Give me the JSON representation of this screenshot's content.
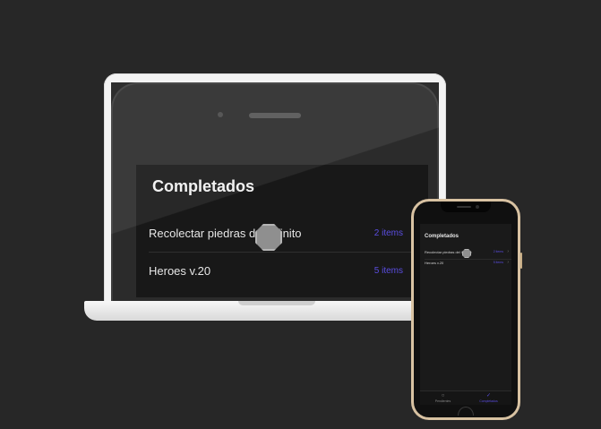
{
  "app": {
    "title": "Completados",
    "items": [
      {
        "label": "Recolectar piedras del infinito",
        "count": "2 items"
      },
      {
        "label": "Heroes v.20",
        "count": "5 items"
      }
    ]
  },
  "tabbar": {
    "tabs": [
      {
        "label": "Pendientes",
        "icon": "circle-icon",
        "active": false
      },
      {
        "label": "Completados",
        "icon": "check-icon",
        "active": true
      }
    ]
  },
  "icons": {
    "chevron": "chevron-right-icon"
  },
  "colors": {
    "background": "#272727",
    "accent": "#5a4de0",
    "phone_frame": "#d8c2a2",
    "laptop_frame": "#f3f3f3"
  }
}
